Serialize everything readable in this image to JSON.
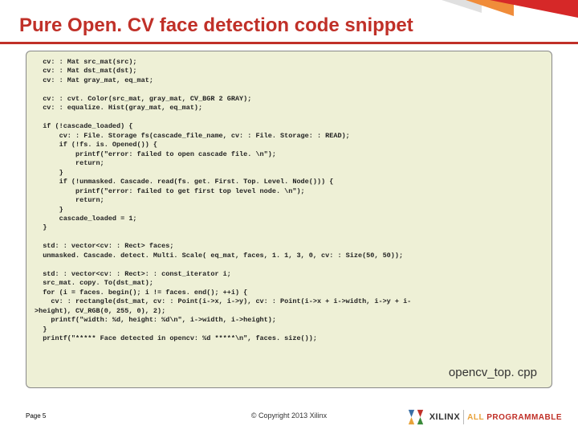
{
  "slide": {
    "title": "Pure Open. CV face detection code snippet",
    "code": "  cv: : Mat src_mat(src);\n  cv: : Mat dst_mat(dst);\n  cv: : Mat gray_mat, eq_mat;\n\n  cv: : cvt. Color(src_mat, gray_mat, CV_BGR 2 GRAY);\n  cv: : equalize. Hist(gray_mat, eq_mat);\n\n  if (!cascade_loaded) {\n      cv: : File. Storage fs(cascade_file_name, cv: : File. Storage: : READ);\n      if (!fs. is. Opened()) {\n          printf(\"error: failed to open cascade file. \\n\");\n          return;\n      }\n      if (!unmasked. Cascade. read(fs. get. First. Top. Level. Node())) {\n          printf(\"error: failed to get first top level node. \\n\");\n          return;\n      }\n      cascade_loaded = 1;\n  }\n\n  std: : vector<cv: : Rect> faces;\n  unmasked. Cascade. detect. Multi. Scale( eq_mat, faces, 1. 1, 3, 0, cv: : Size(50, 50));\n\n  std: : vector<cv: : Rect>: : const_iterator i;\n  src_mat. copy. To(dst_mat);\n  for (i = faces. begin(); i != faces. end(); ++i) {\n    cv: : rectangle(dst_mat, cv: : Point(i->x, i->y), cv: : Point(i->x + i->width, i->y + i-\n>height), CV_RGB(0, 255, 0), 2);\n    printf(\"width: %d, height: %d\\n\", i->width, i->height);\n  }\n  printf(\"***** Face detected in opencv: %d *****\\n\", faces. size());",
    "filename": "opencv_top. cpp",
    "page_label": "Page 5",
    "copyright": "© Copyright 2013 Xilinx",
    "brand": {
      "name": "XILINX",
      "tagline_all": "ALL ",
      "tagline_prog": "PROGRAMMABLE"
    }
  }
}
